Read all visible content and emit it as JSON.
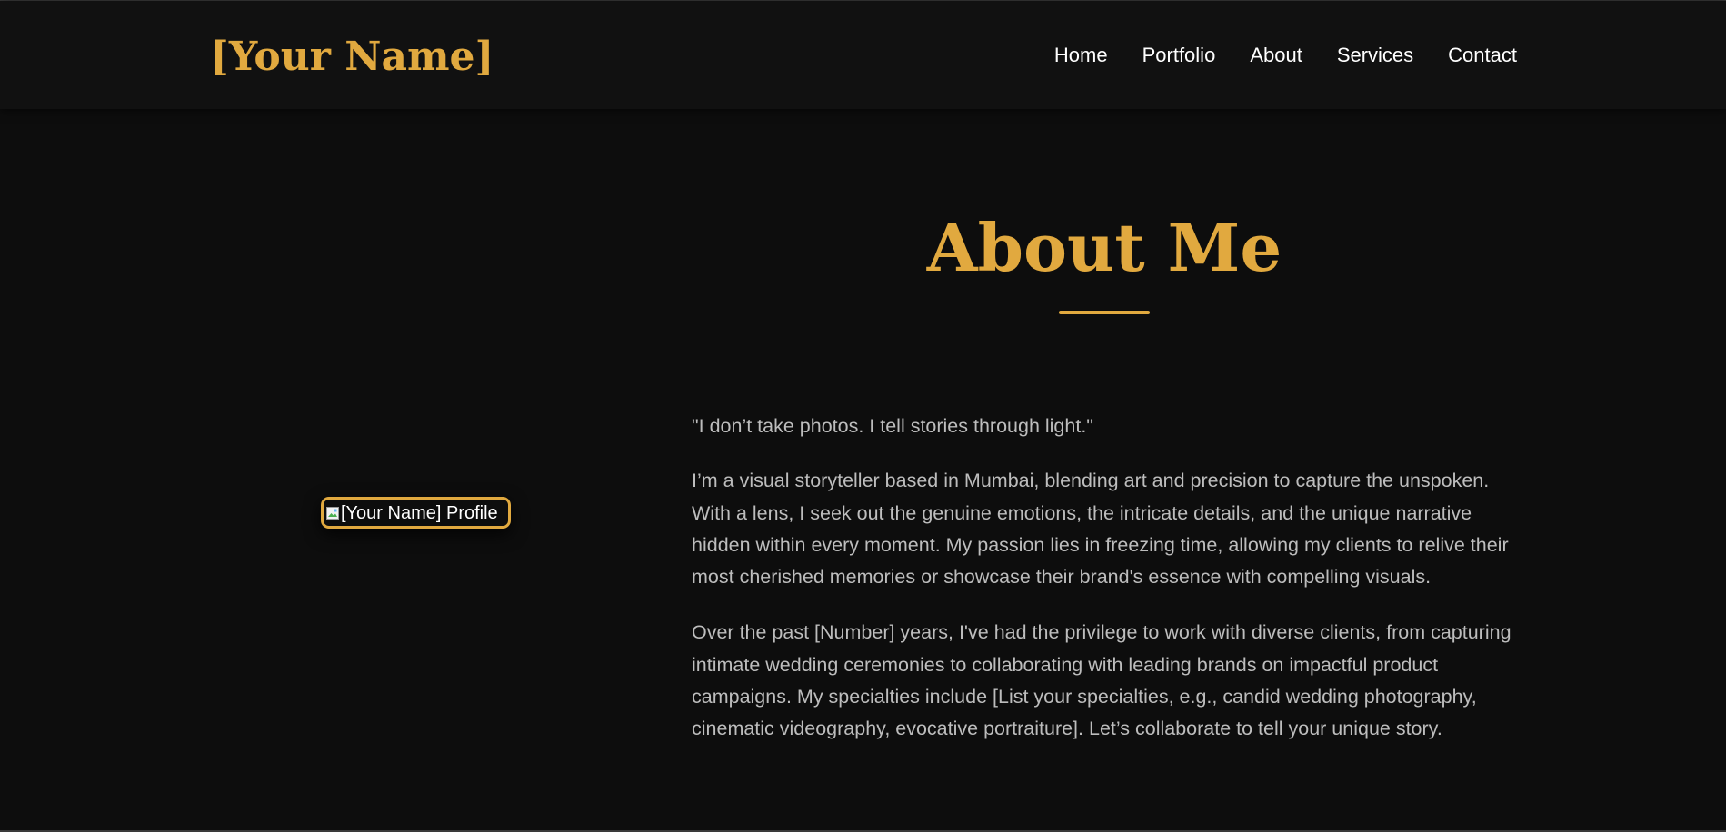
{
  "header": {
    "logo": "[Your Name]",
    "nav": [
      "Home",
      "Portfolio",
      "About",
      "Services",
      "Contact"
    ]
  },
  "about": {
    "title": "About Me",
    "profile_image_alt": "[Your Name] Profile",
    "quote": "\"I don’t take photos. I tell stories through light.\"",
    "paragraph_1": "I’m a visual storyteller based in Mumbai, blending art and precision to capture the unspoken. With a lens, I seek out the genuine emotions, the intricate details, and the unique narrative hidden within every moment. My passion lies in freezing time, allowing my clients to relive their most cherished memories or showcase their brand's essence with compelling visuals.",
    "paragraph_2": "Over the past [Number] years, I've had the privilege to work with diverse clients, from capturing intimate wedding ceremonies to collaborating with leading brands on impactful product campaigns. My specialties include [List your specialties, e.g., candid wedding photography, cinematic videography, evocative portraiture]. Let’s collaborate to tell your unique story."
  },
  "colors": {
    "accent": "#e1a93f",
    "background": "#0d0d0d",
    "header_background": "#111111",
    "body_text": "#bdbdbd",
    "nav_text": "#ffffff"
  },
  "icons": {
    "profile_image": "broken-image-icon"
  }
}
